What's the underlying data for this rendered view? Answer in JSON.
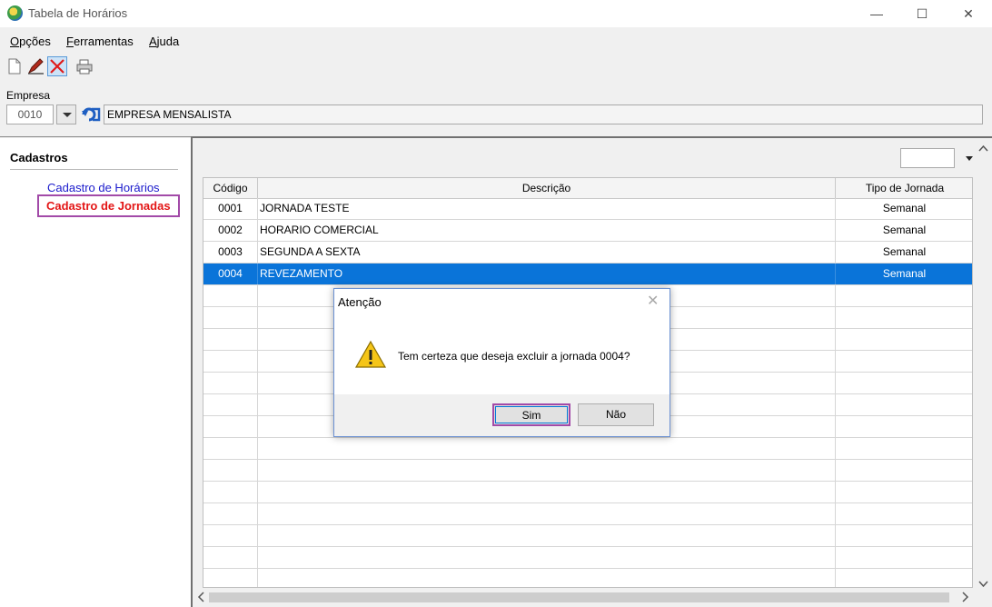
{
  "window": {
    "title": "Tabela de Horários",
    "minimize": "—",
    "maximize": "☐",
    "close": "✕"
  },
  "menu": [
    {
      "first": "O",
      "rest": "pções"
    },
    {
      "first": "F",
      "rest": "erramentas"
    },
    {
      "first": "A",
      "rest": "juda"
    }
  ],
  "empresa": {
    "label": "Empresa",
    "code": "0010",
    "name": "EMPRESA MENSALISTA"
  },
  "sidebar": {
    "title": "Cadastros",
    "items": [
      "Cadastro de Horários",
      "Cadastro de Jornadas"
    ]
  },
  "grid": {
    "headers": [
      "Código",
      "Descrição",
      "Tipo de Jornada"
    ],
    "rows": [
      {
        "code": "0001",
        "desc": "JORNADA TESTE",
        "tipo": "Semanal"
      },
      {
        "code": "0002",
        "desc": "HORARIO COMERCIAL",
        "tipo": "Semanal"
      },
      {
        "code": "0003",
        "desc": "SEGUNDA A SEXTA",
        "tipo": "Semanal"
      },
      {
        "code": "0004",
        "desc": "REVEZAMENTO",
        "tipo": "Semanal"
      }
    ]
  },
  "dialog": {
    "title": "Atenção",
    "message": "Tem certeza que deseja excluir a jornada 0004?",
    "yes": "Sim",
    "no": "Não",
    "close": "✕"
  },
  "colors": {
    "selection": "#0a74d9",
    "highlight_border": "#a24aa8",
    "link_blue": "#1a1acc",
    "link_red": "#e31616"
  }
}
